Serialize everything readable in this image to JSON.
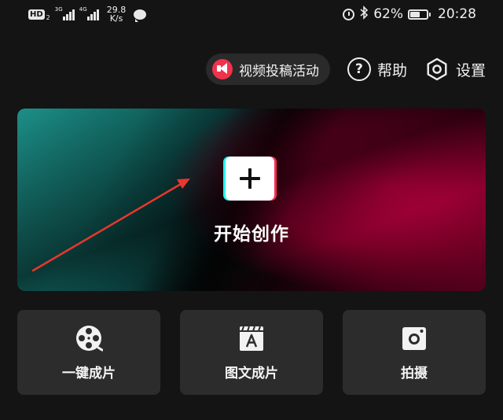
{
  "status_bar": {
    "hd": "HD",
    "hd_sub": "2",
    "signal_1_gen": "3G",
    "signal_2_gen": "4G",
    "net_speed_value": "29.8",
    "net_speed_unit": "K/s",
    "battery_percent": "62%",
    "battery_level": 0.62,
    "time": "20:28"
  },
  "top_actions": {
    "campaign_label": "视频投稿活动",
    "help_label": "帮助",
    "help_glyph": "?",
    "settings_label": "设置"
  },
  "banner": {
    "create_label": "开始创作"
  },
  "tools": [
    {
      "label": "一键成片",
      "icon": "film-reel-icon"
    },
    {
      "label": "图文成片",
      "icon": "text-clapper-icon"
    },
    {
      "label": "拍摄",
      "icon": "camera-icon"
    }
  ],
  "colors": {
    "background": "#141414",
    "card": "#2c2c2c",
    "accent_red": "#f0324c",
    "teal": "#1d9089",
    "magenta": "#b8003f",
    "annotation_arrow": "#e8372c"
  }
}
